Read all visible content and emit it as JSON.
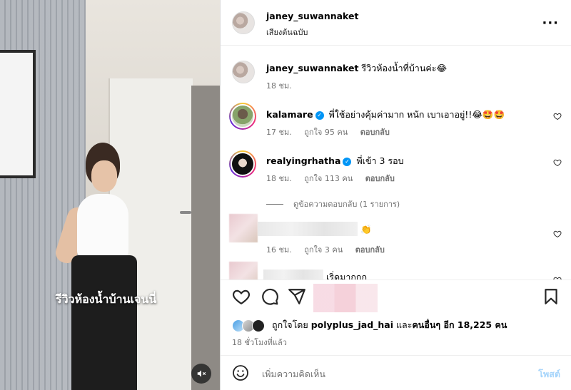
{
  "video": {
    "overlay_text": "รีวิวห้องน้ำบ้านเจนนี่"
  },
  "post": {
    "author": "janey_suwannaket",
    "audio": "เสียงต้นฉบับ",
    "caption_user": "janey_suwannaket",
    "caption_text": "รีวิวห้องน้ำที่บ้านค่ะ😂",
    "caption_time": "18 ชม."
  },
  "comments": [
    {
      "user": "kalamare",
      "verified": true,
      "text": "พี่ใช้อย่างคุ้มค่ามาก หนัก เบาเอาอยู่!!😂🤩🤩",
      "time": "17 ชม.",
      "likes": "ถูกใจ 95 คน",
      "reply": "ตอบกลับ"
    },
    {
      "user": "realyingrhatha",
      "verified": true,
      "text": "พี่เข้า 3 รอบ",
      "time": "18 ชม.",
      "likes": "ถูกใจ 113 คน",
      "reply": "ตอบกลับ",
      "view_replies": "ดูข้อความตอบกลับ (1 รายการ)"
    },
    {
      "user": "",
      "text": "👏",
      "time": "16 ชม.",
      "likes": "ถูกใจ 3 คน",
      "reply": "ตอบกลับ"
    },
    {
      "user": "",
      "text": "เริ่ดมากกก"
    }
  ],
  "likes": {
    "prefix": "ถูกใจโดย ",
    "user": "polyplus_jad_hai",
    "middle": " และ",
    "others": "คนอื่นๆ อีก 18,225 คน"
  },
  "time_ago": "18 ชั่วโมงที่แล้ว",
  "composer": {
    "placeholder": "เพิ่มความคิดเห็น",
    "post_label": "โพสต์"
  },
  "icons": {
    "like": "heart-icon",
    "comment": "comment-icon",
    "share": "share-icon",
    "save": "bookmark-icon",
    "more": "more-icon",
    "mute": "speaker-muted-icon",
    "emoji": "emoji-icon"
  },
  "colors": {
    "link_blue": "#0095f6",
    "post_disabled": "#a5d4fb",
    "secondary_text": "#737373"
  }
}
